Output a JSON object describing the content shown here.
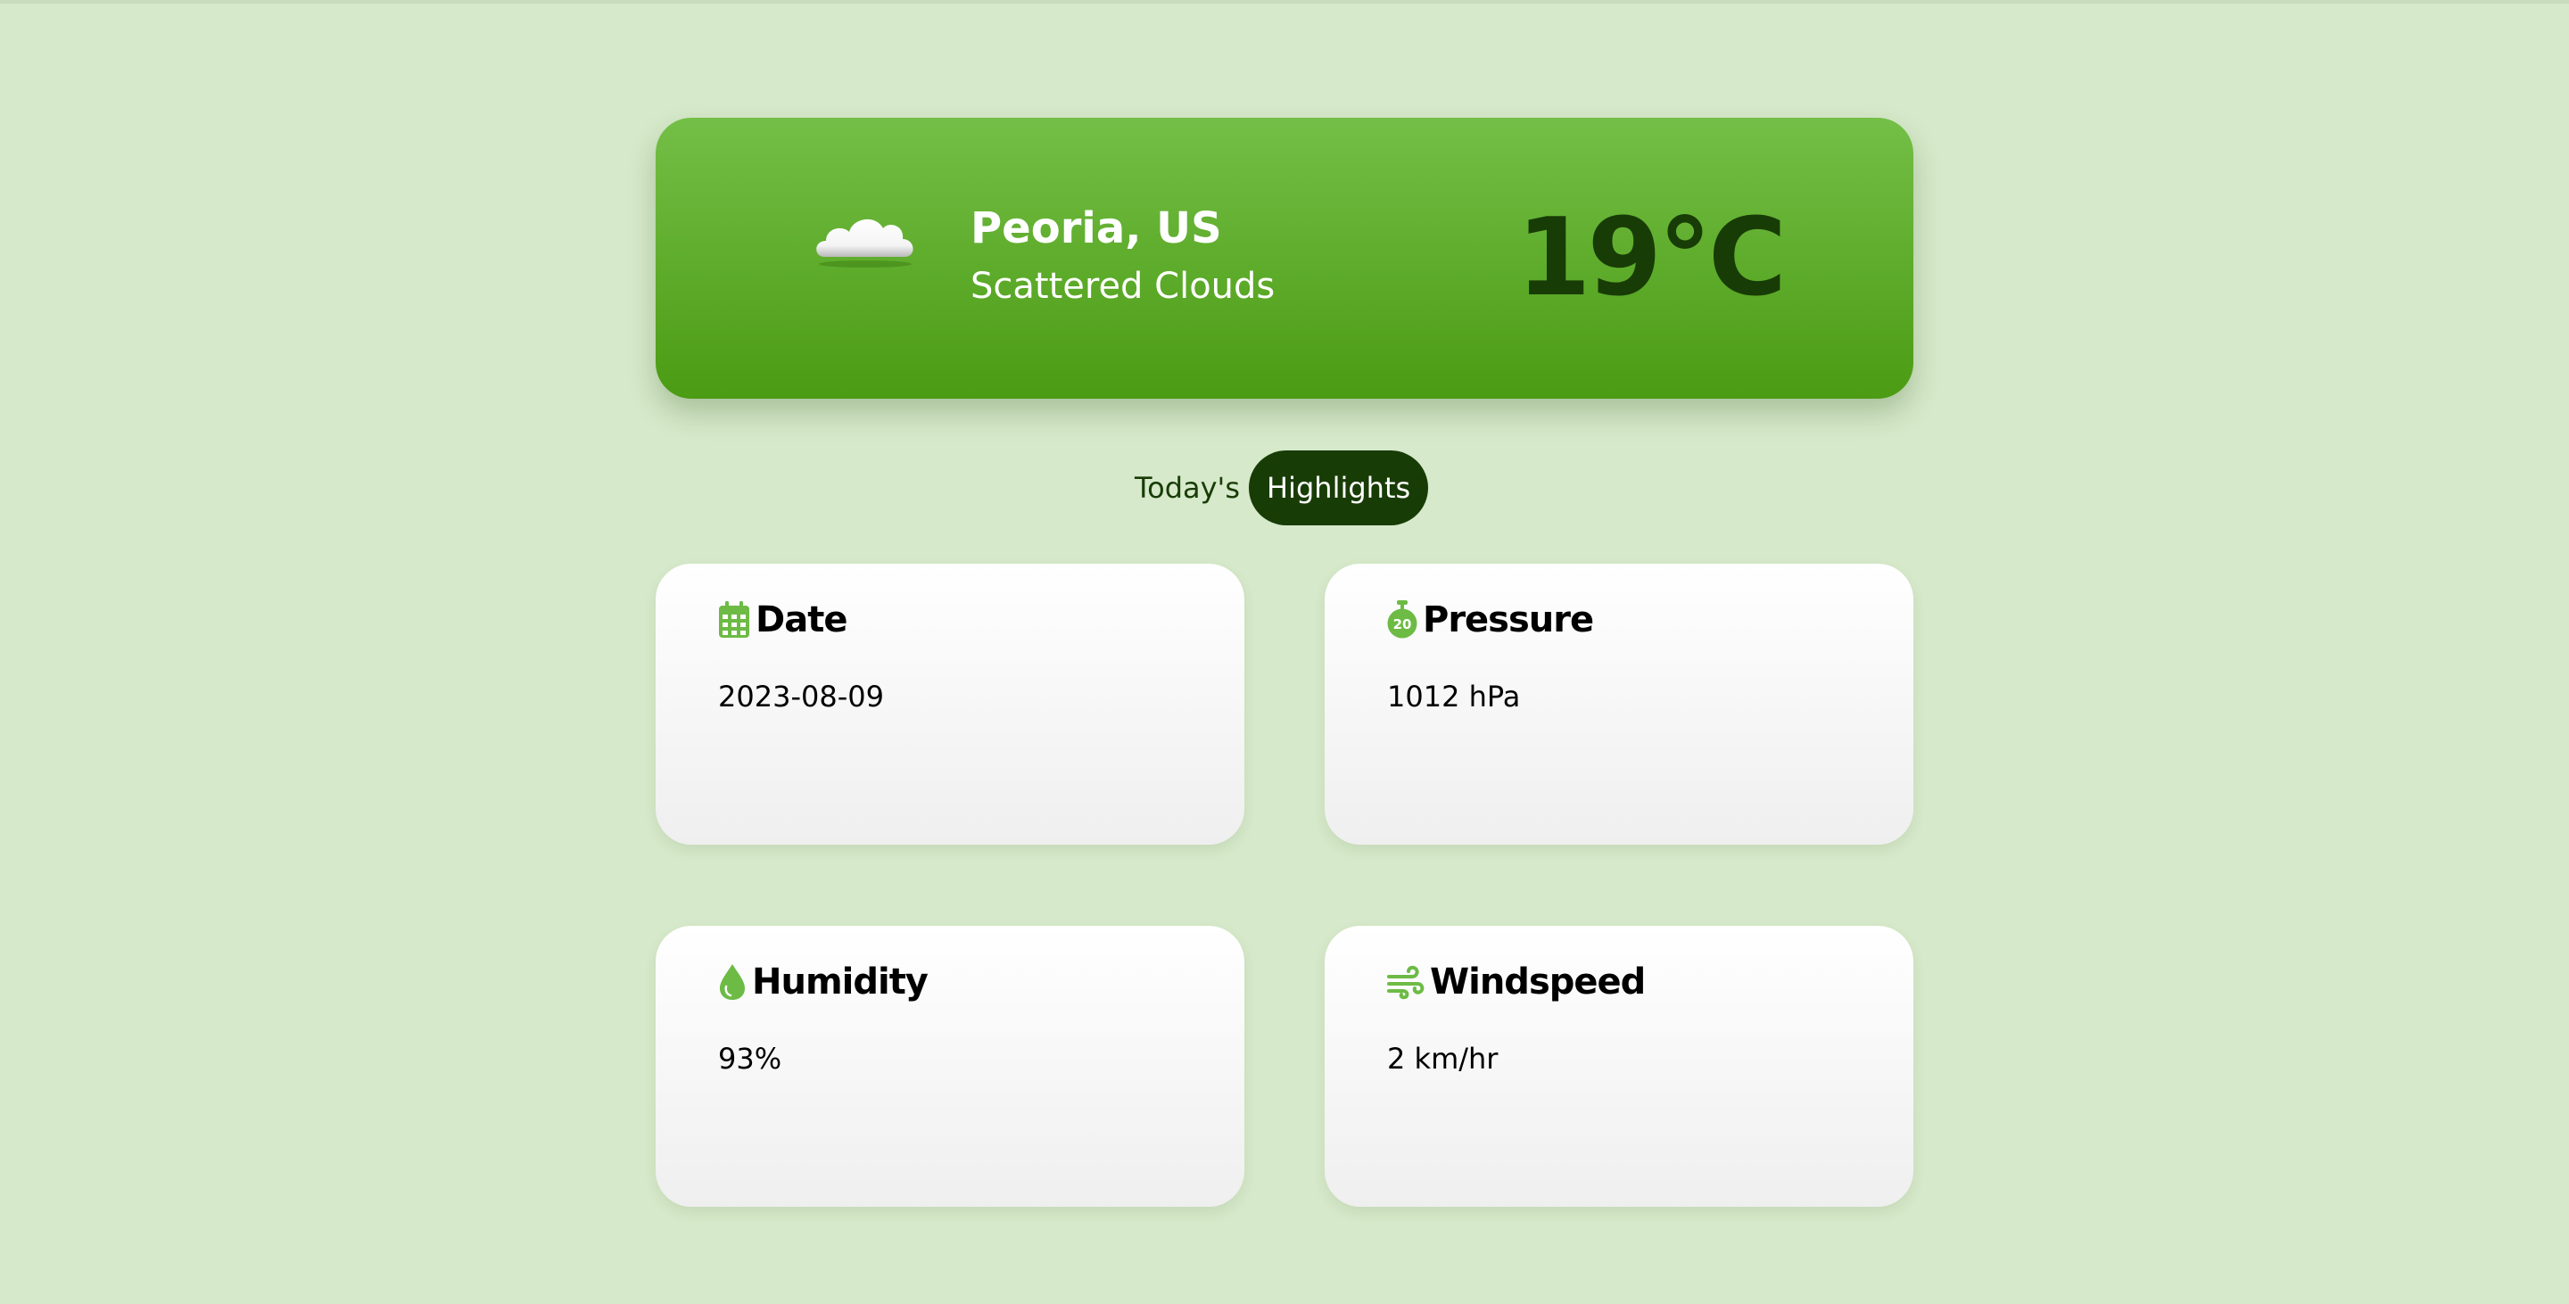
{
  "hero": {
    "location": "Peoria, US",
    "condition": "Scattered Clouds",
    "temperature": "19°C",
    "icon": "cloud-icon"
  },
  "section": {
    "lead": "Today's",
    "highlight": "Highlights"
  },
  "cards": [
    {
      "title": "Date",
      "value": "2023-08-09",
      "icon": "calendar-icon"
    },
    {
      "title": "Pressure",
      "value": "1012 hPa",
      "icon": "stopwatch-icon"
    },
    {
      "title": "Humidity",
      "value": "93%",
      "icon": "droplet-icon"
    },
    {
      "title": "Windspeed",
      "value": "2 km/hr",
      "icon": "wind-icon"
    }
  ],
  "colors": {
    "background": "#d6e9ca",
    "hero_top": "#74bf47",
    "hero_bottom": "#4b9b13",
    "accent_dark": "#183c06",
    "icon_green": "#6dbb45"
  }
}
